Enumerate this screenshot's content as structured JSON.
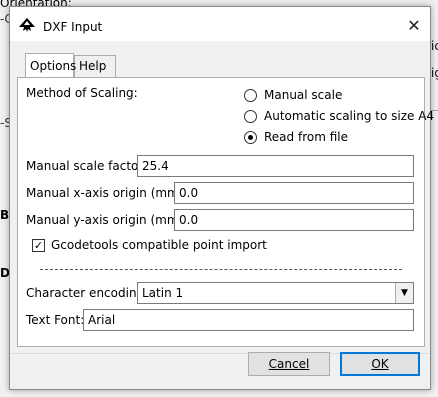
{
  "background": {
    "text_top": "Orientation:",
    "frag_c": "-C",
    "frag_s": "-S",
    "frag_ba": "Ba",
    "frag_di": "Di",
    "frag_ic": "ic",
    "frag_ig": "ig"
  },
  "dialog": {
    "title": "DXF Input",
    "close_glyph": "✕",
    "tabs": [
      "Options",
      "Help"
    ],
    "method_label": "Method of Scaling:",
    "scaling_options": [
      {
        "label": "Manual scale",
        "checked": false
      },
      {
        "label": "Automatic scaling to size A4",
        "checked": false
      },
      {
        "label": "Read from file",
        "checked": true
      }
    ],
    "manual_scale_label": "Manual scale factor:",
    "manual_scale_value": "25.4",
    "x_origin_label": "Manual x-axis origin (mm):",
    "x_origin_value": "0.0",
    "y_origin_label": "Manual y-axis origin (mm):",
    "y_origin_value": "0.0",
    "gcode_label": "Gcodetools compatible point import",
    "gcode_checked": true,
    "encoding_label": "Character encoding:",
    "encoding_value": "Latin 1",
    "font_label": "Text Font:",
    "font_value": "Arial",
    "cancel_label": "Cancel",
    "ok_label": "OK",
    "accent_color": "#0078d7"
  }
}
